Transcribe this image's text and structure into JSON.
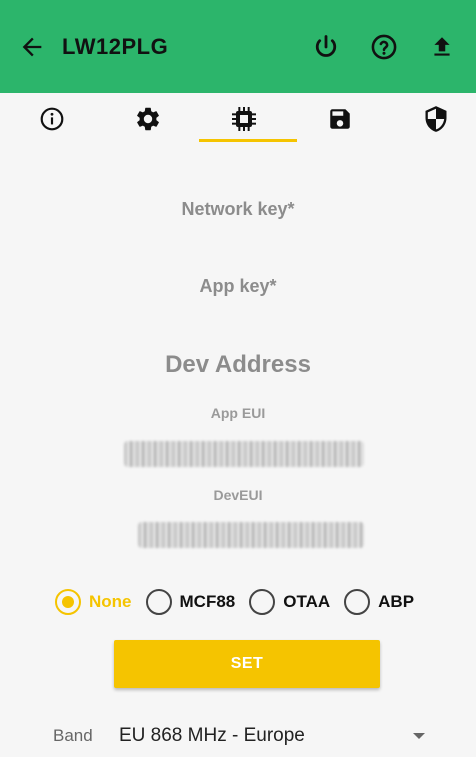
{
  "header": {
    "title": "LW12PLG",
    "icons": [
      "arrow-back-icon",
      "power-icon",
      "help-icon",
      "upload-icon"
    ],
    "background": "#2cb56b"
  },
  "tabs": [
    {
      "name": "info-icon",
      "selected": false
    },
    {
      "name": "gear-icon",
      "selected": false
    },
    {
      "name": "chip-icon",
      "selected": true
    },
    {
      "name": "save-icon",
      "selected": false
    },
    {
      "name": "shield-icon",
      "selected": false
    }
  ],
  "fields": {
    "network_key": "Network key*",
    "app_key": "App key*",
    "dev_address": "Dev Address",
    "app_eui": "App EUI",
    "dev_eui": "DevEUI"
  },
  "activation": {
    "options": [
      "None",
      "MCF88",
      "OTAA",
      "ABP"
    ],
    "selected": "None"
  },
  "set_button": "SET",
  "band": {
    "label": "Band",
    "value": "EU 868 MHz - Europe"
  },
  "colors": {
    "accent": "#f5c400",
    "header": "#2cb56b"
  }
}
